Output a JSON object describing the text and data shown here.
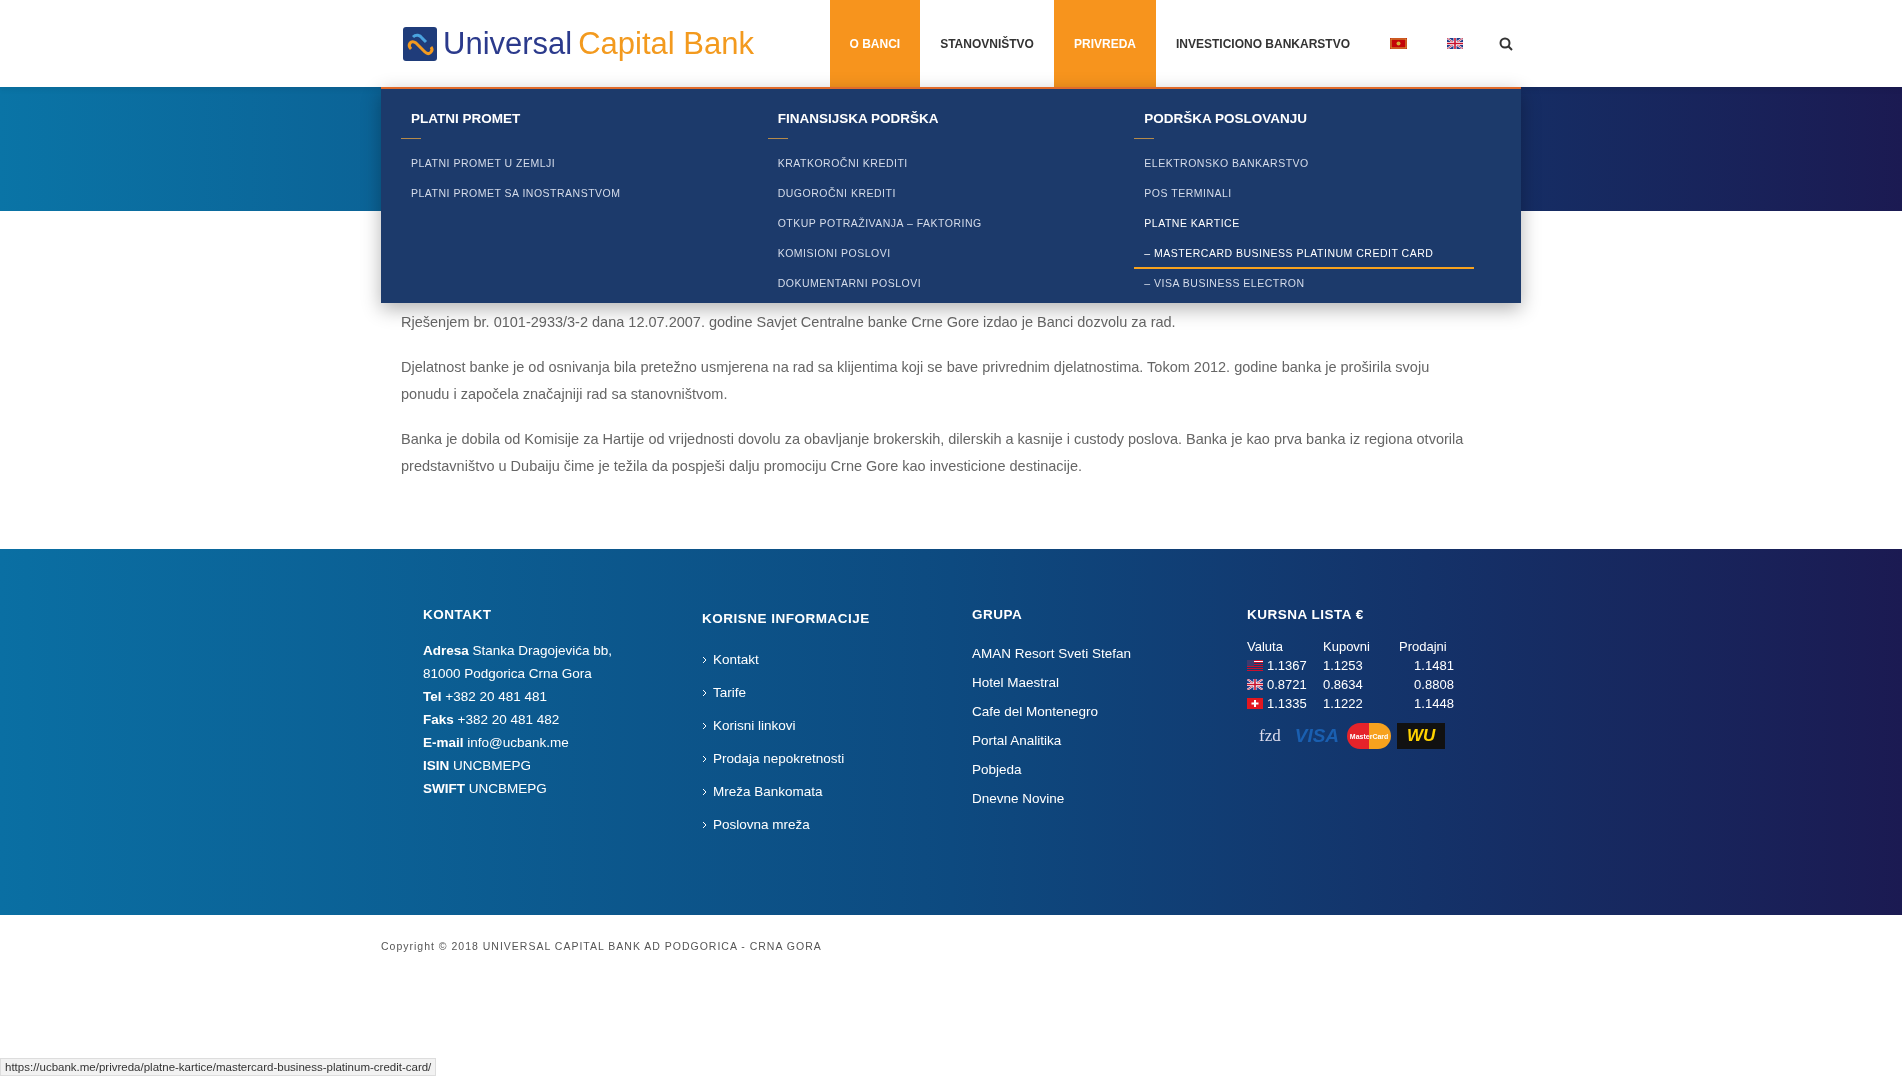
{
  "logo": {
    "first": "Universal",
    "second": "Capital Bank"
  },
  "nav": [
    {
      "label": "O BANCI",
      "highlighted": true
    },
    {
      "label": "STANOVNIŠTVO",
      "highlighted": false
    },
    {
      "label": "PRIVREDA",
      "highlighted": true
    },
    {
      "label": "INVESTICIONO BANKARSTVO",
      "highlighted": false
    }
  ],
  "languages": [
    {
      "kind": "me"
    },
    {
      "kind": "en"
    }
  ],
  "mega_menu": [
    {
      "title": "PLATNI PROMET",
      "items": [
        {
          "label": "PLATNI PROMET U ZEMLJI",
          "current": false,
          "hovered": false
        },
        {
          "label": "PLATNI PROMET SA INOSTRANSTVOM",
          "current": false,
          "hovered": false
        }
      ]
    },
    {
      "title": "FINANSIJSKA PODRŠKA",
      "items": [
        {
          "label": "KRATKOROČNI KREDITI",
          "current": false,
          "hovered": false
        },
        {
          "label": "DUGOROČNI KREDITI",
          "current": false,
          "hovered": false
        },
        {
          "label": "OTKUP POTRAŽIVANJA – FAKTORING",
          "current": false,
          "hovered": false
        },
        {
          "label": "KOMISIONI POSLOVI",
          "current": false,
          "hovered": false
        },
        {
          "label": "DOKUMENTARNI POSLOVI",
          "current": false,
          "hovered": false
        }
      ]
    },
    {
      "title": "PODRŠKA POSLOVANJU",
      "items": [
        {
          "label": "ELEKTRONSKO BANKARSTVO",
          "current": false,
          "hovered": false
        },
        {
          "label": "POS TERMINALI",
          "current": false,
          "hovered": false
        },
        {
          "label": "PLATNE KARTICE",
          "current": true,
          "hovered": false
        },
        {
          "label": "– MASTERCARD BUSINESS PLATINUM CREDIT CARD",
          "current": true,
          "hovered": true
        },
        {
          "label": "– VISA BUSINESS ELECTRON",
          "current": false,
          "hovered": false
        }
      ]
    }
  ],
  "content": [
    "Rješenjem br. 0101-2933/3-2 dana 12.07.2007. godine Savjet Centralne banke Crne Gore izdao je Banci dozvolu za rad.",
    "Djelatnost banke je od osnivanja bila pretežno usmjerena na rad sa klijentima koji se bave privrednim djelatnostima. Tokom 2012. godine banka je proširila svoju ponudu i započela značajniji rad sa stanovništvom.",
    "Banka je dobila od Komisije za Hartije od vrijednosti dovolu za obavljanje brokerskih, dilerskih a kasnije i custody poslova. Banka je kao prva banka iz regiona otvorila predstavništvo u Dubaiju čime je težila da pospješi dalju promociju Crne Gore kao investicione destinacije."
  ],
  "footer": {
    "contact": {
      "title": "KONTAKT",
      "lines": [
        "**Adresa** Stanka Dragojevića bb,",
        "81000 Podgorica Crna Gora",
        "**Tel** +382 20 481 481",
        "**Faks** +382 20 481 482",
        "**E-mail** info@ucbank.me",
        "**ISIN** UNCBMEPG",
        "**SWIFT** UNCBMEPG"
      ]
    },
    "useful": {
      "title": "KORISNE INFORMACIJE",
      "links": [
        "Kontakt",
        "Tarife",
        "Korisni linkovi",
        "Prodaja nepokretnosti",
        "Mreža Bankomata",
        "Poslovna mreža"
      ]
    },
    "group": {
      "title": "GRUPA",
      "links": [
        "AMAN Resort Sveti Stefan",
        "Hotel Maestral",
        "Cafe del Montenegro",
        "Portal Analitika",
        "Pobjeda",
        "Dnevne Novine"
      ]
    },
    "rates": {
      "title": "KURSNA LISTA €",
      "columns": [
        "Valuta",
        "Kupovni",
        "Prodajni"
      ],
      "rows": [
        {
          "kind": "usd",
          "cells": [
            "1.1367",
            "1.1253",
            "1.1481"
          ]
        },
        {
          "kind": "gbp",
          "cells": [
            "0.8721",
            "0.8634",
            "0.8808"
          ]
        },
        {
          "kind": "chf",
          "cells": [
            "1.1335",
            "1.1222",
            "1.1448"
          ]
        }
      ],
      "logos": [
        {
          "kind": "fzd",
          "text": "fzd"
        },
        {
          "kind": "visa",
          "text": "VISA"
        },
        {
          "kind": "mastercard",
          "text": "MasterCard"
        },
        {
          "kind": "wu",
          "text": "WU"
        }
      ]
    }
  },
  "copyright": "Copyright © 2018 UNIVERSAL CAPITAL BANK AD PODGORICA - CRNA GORA",
  "status_bar": "https://ucbank.me/privreda/platne-kartice/mastercard-business-platinum-credit-card/"
}
